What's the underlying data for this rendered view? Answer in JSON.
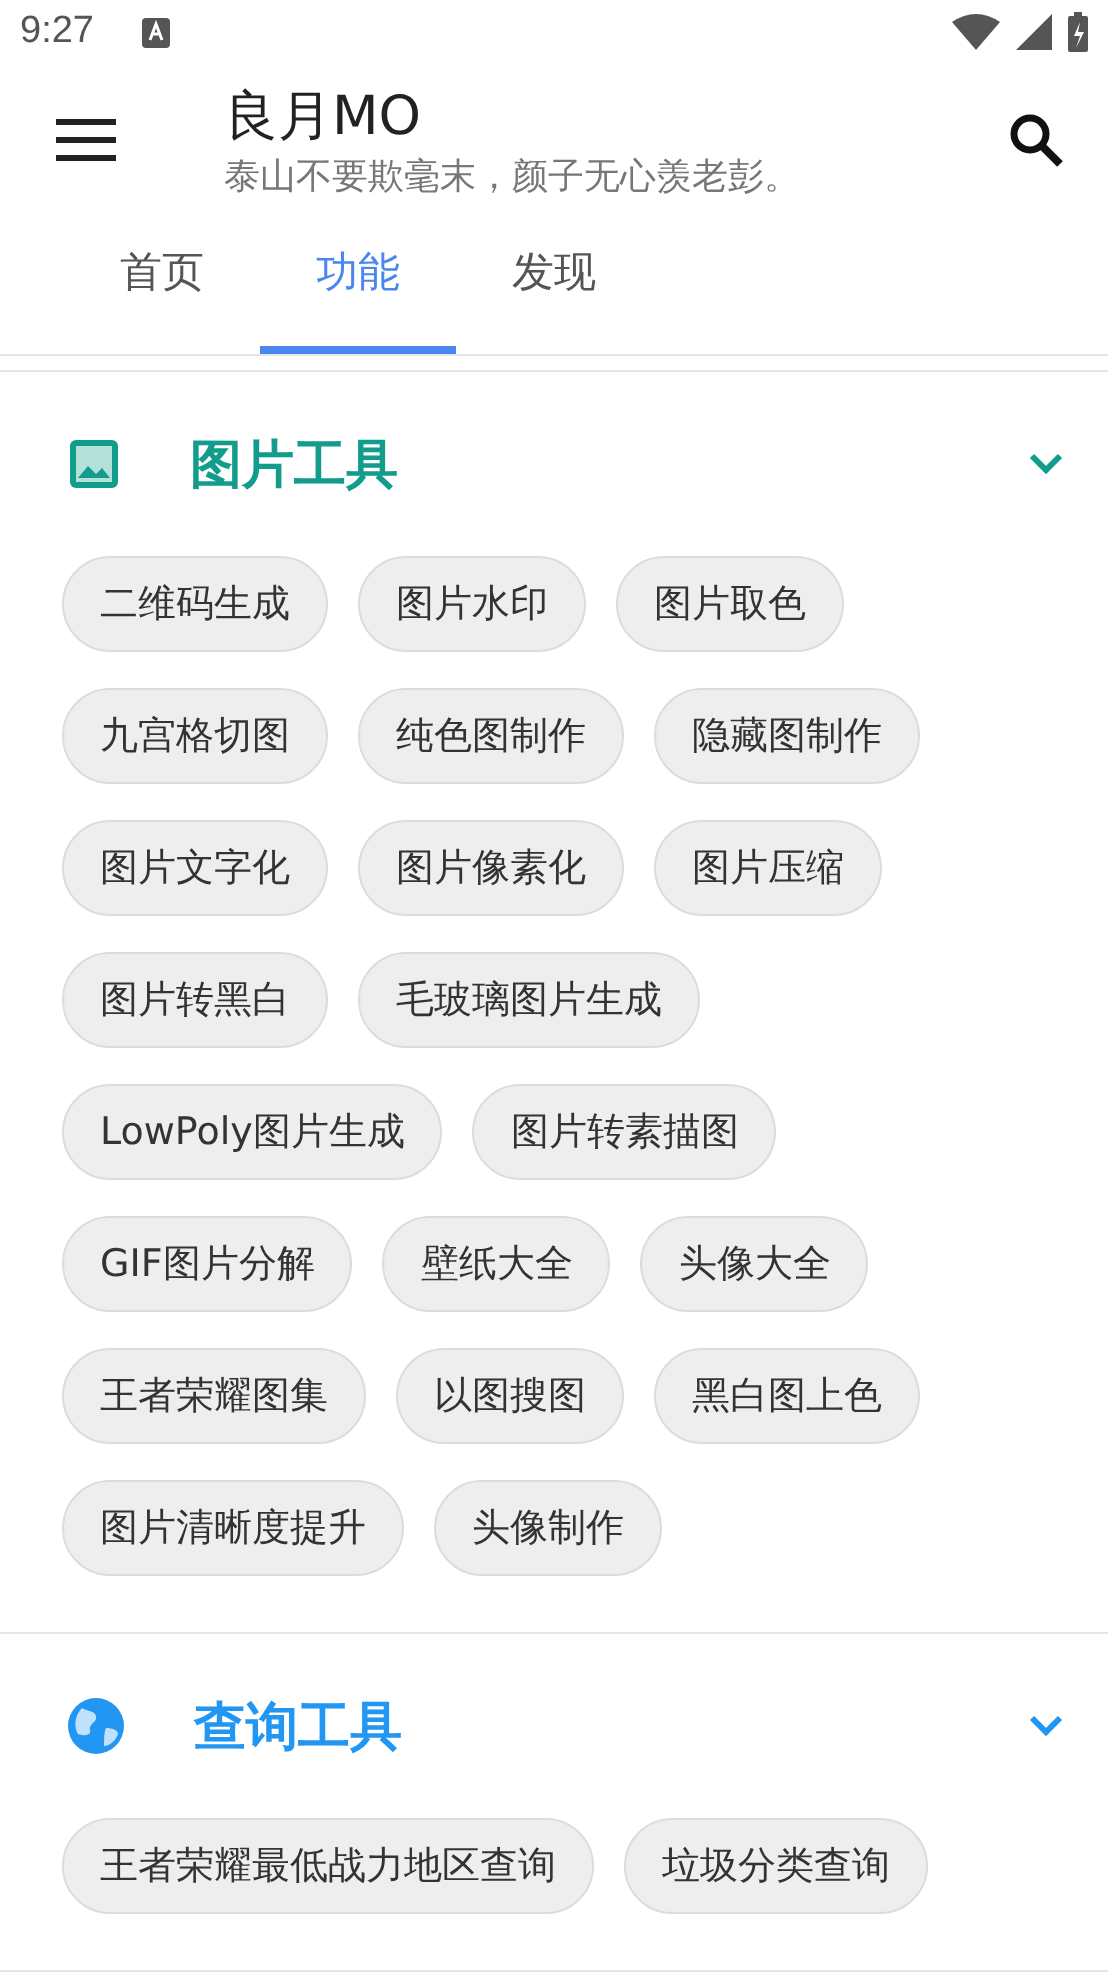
{
  "status_bar": {
    "time": "9:27"
  },
  "app_bar": {
    "title": "良月MO",
    "subtitle": "泰山不要欺毫末，颜子无心羡老彭。"
  },
  "tabs": [
    {
      "label": "首页",
      "selected": false
    },
    {
      "label": "功能",
      "selected": true
    },
    {
      "label": "发现",
      "selected": false
    }
  ],
  "sections": [
    {
      "kind": "image",
      "title": "图片工具",
      "color": "#129c8c",
      "expanded": true,
      "items": [
        "二维码生成",
        "图片水印",
        "图片取色",
        "九宫格切图",
        "纯色图制作",
        "隐藏图制作",
        "图片文字化",
        "图片像素化",
        "图片压缩",
        "图片转黑白",
        "毛玻璃图片生成",
        "LowPoly图片生成",
        "图片转素描图",
        "GIF图片分解",
        "壁纸大全",
        "头像大全",
        "王者荣耀图集",
        "以图搜图",
        "黑白图上色",
        "图片清晰度提升",
        "头像制作"
      ]
    },
    {
      "kind": "globe",
      "title": "查询工具",
      "color": "#2196f3",
      "expanded": true,
      "items": [
        "王者荣耀最低战力地区查询",
        "垃圾分类查询"
      ]
    }
  ]
}
